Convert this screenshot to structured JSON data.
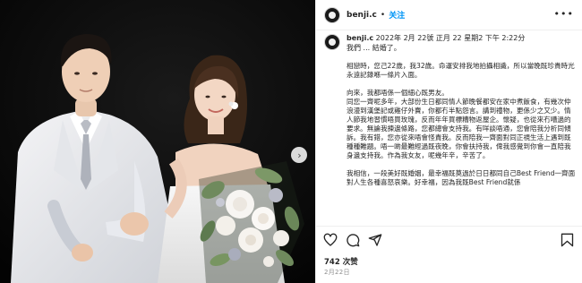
{
  "post": {
    "username": "benji.c",
    "follow_label": "关注",
    "more_icon": "more-icon",
    "caption_time": "2022年 2月 22號 正月 22 星期2 下午 2:22分",
    "caption_first_line": "我們 ... 結婚了。",
    "paragraphs": [
      "相戀時，您己22歲，我32歲。命運安排我地拍攝相識，所以當晚既珍貴時光永遠記錄喺一條片入面。",
      "向來，我都唔係一個細心既男友。",
      "同您一齊呢多年，大部份生日都同情人節晚餐都安在家中煮飯食，有幾次仲浪漫到漢堡記或雞仔外賣，你都冇半點怨言。講到禮物，更係少之又少。情人節我地習慣唔買玫瑰，反而年年買標糟物返屋企。懷疑，也從來冇嘈過的要求。無論我揀邊條路，您都總會支持我。有咩談唔通，您會陪我分析同傾訴。我有錯，您亦從來唔會怪責我。反而陪我一齊面對同正視生活上遇到既種種難題。唔一啲最難經過既夜晚，你會扶持我，俾我感覺到你會一直陪我身邊支持我。作為我女友，呢幾年辛，辛苦了。",
      "我相信，一段美好既婚姻，最幸福既莫過於日日都同自己Best Friend一齊面對人生各種喜怒哀樂。好幸福，因為我既Best Friend就係"
    ],
    "likes": "742 次赞",
    "date": "2月22日"
  },
  "icons": {
    "like": "heart-icon",
    "comment": "comment-icon",
    "share": "share-icon",
    "save": "bookmark-icon",
    "next": "chevron-right-icon"
  },
  "next_glyph": "›"
}
